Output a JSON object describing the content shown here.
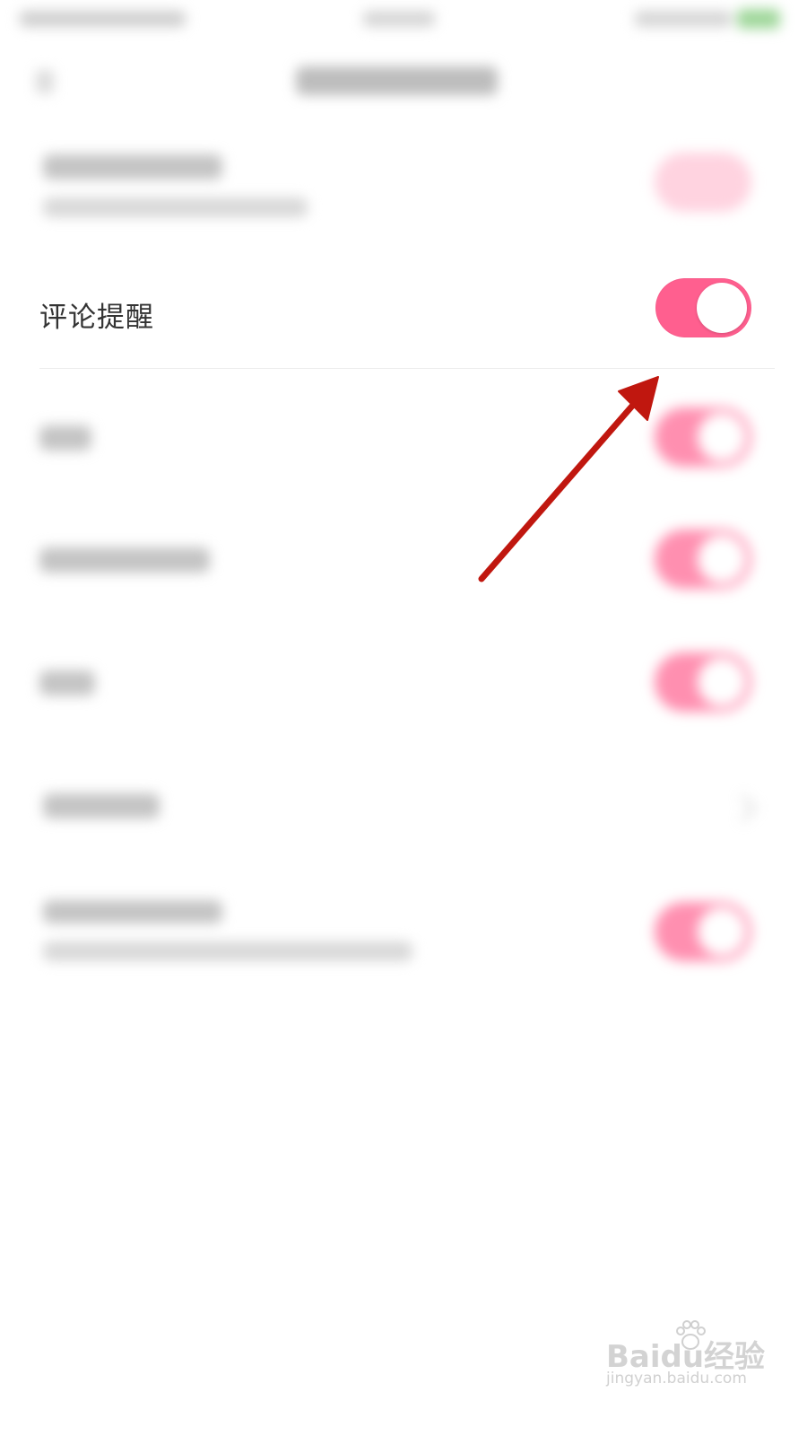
{
  "settings": {
    "comment_reminder": {
      "label": "评论提醒",
      "enabled": true
    }
  },
  "colors": {
    "toggle_on": "#ff5f8f",
    "annotation_arrow": "#c0170f"
  },
  "watermark": {
    "logo_text": "Baidu经验",
    "url": "jingyan.baidu.com"
  }
}
